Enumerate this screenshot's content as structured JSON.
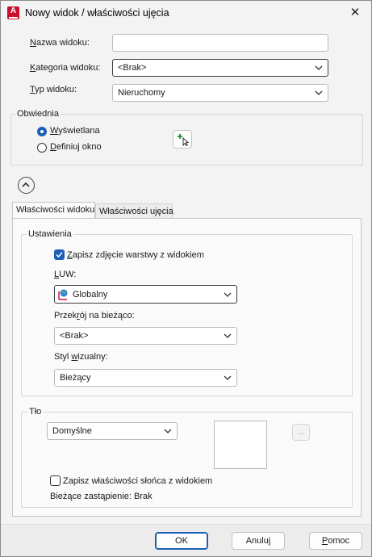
{
  "window": {
    "title": "Nowy widok / właściwości ujęcia",
    "app_icon_letter": "A",
    "close_glyph": "✕"
  },
  "form": {
    "name_label_u": "N",
    "name_label_rest": "azwa widoku:",
    "name_value": "",
    "category_label_u": "K",
    "category_label_rest": "ategoria widoku:",
    "category_value": "<Brak>",
    "type_label_u": "T",
    "type_label_rest": "yp widoku:",
    "type_value": "Nieruchomy"
  },
  "boundary": {
    "caption": "Obwiednia",
    "opt1_u": "W",
    "opt1_rest": "yświetlana",
    "opt1_selected": true,
    "opt2_u": "D",
    "opt2_rest": "efiniuj okno",
    "opt2_selected": false,
    "pick_icon": "pick-window-icon"
  },
  "collapse_icon": "chevron-up-circle-icon",
  "tabs": [
    {
      "label": "Właściwości widoku",
      "active": true
    },
    {
      "label": "Właściwości ujęcia",
      "active": false
    }
  ],
  "settings": {
    "caption": "Ustawienia",
    "save_layer_u": "Z",
    "save_layer_rest": "apisz zdjęcie warstwy z widokiem",
    "save_layer_checked": true,
    "ucs_label_u": "L",
    "ucs_label_rest": "UW:",
    "ucs_value": "Globalny",
    "section_label_pre": "Przek",
    "section_label_u": "r",
    "section_label_post": "ój na bieżąco:",
    "section_value": "<Brak>",
    "style_label_pre": "Styl ",
    "style_label_u": "w",
    "style_label_post": "izualny:",
    "style_value": "Bieżący"
  },
  "background": {
    "caption": "Tło",
    "type_value": "Domyślne",
    "browse_label": "...",
    "sun_label": "Zapisz właściwości słońca z widokiem",
    "sun_checked": false,
    "override_label": "Bieżące zastąpienie: Brak"
  },
  "buttons": {
    "ok": "OK",
    "cancel": "Anuluj",
    "help_u": "P",
    "help_rest": "omoc"
  }
}
